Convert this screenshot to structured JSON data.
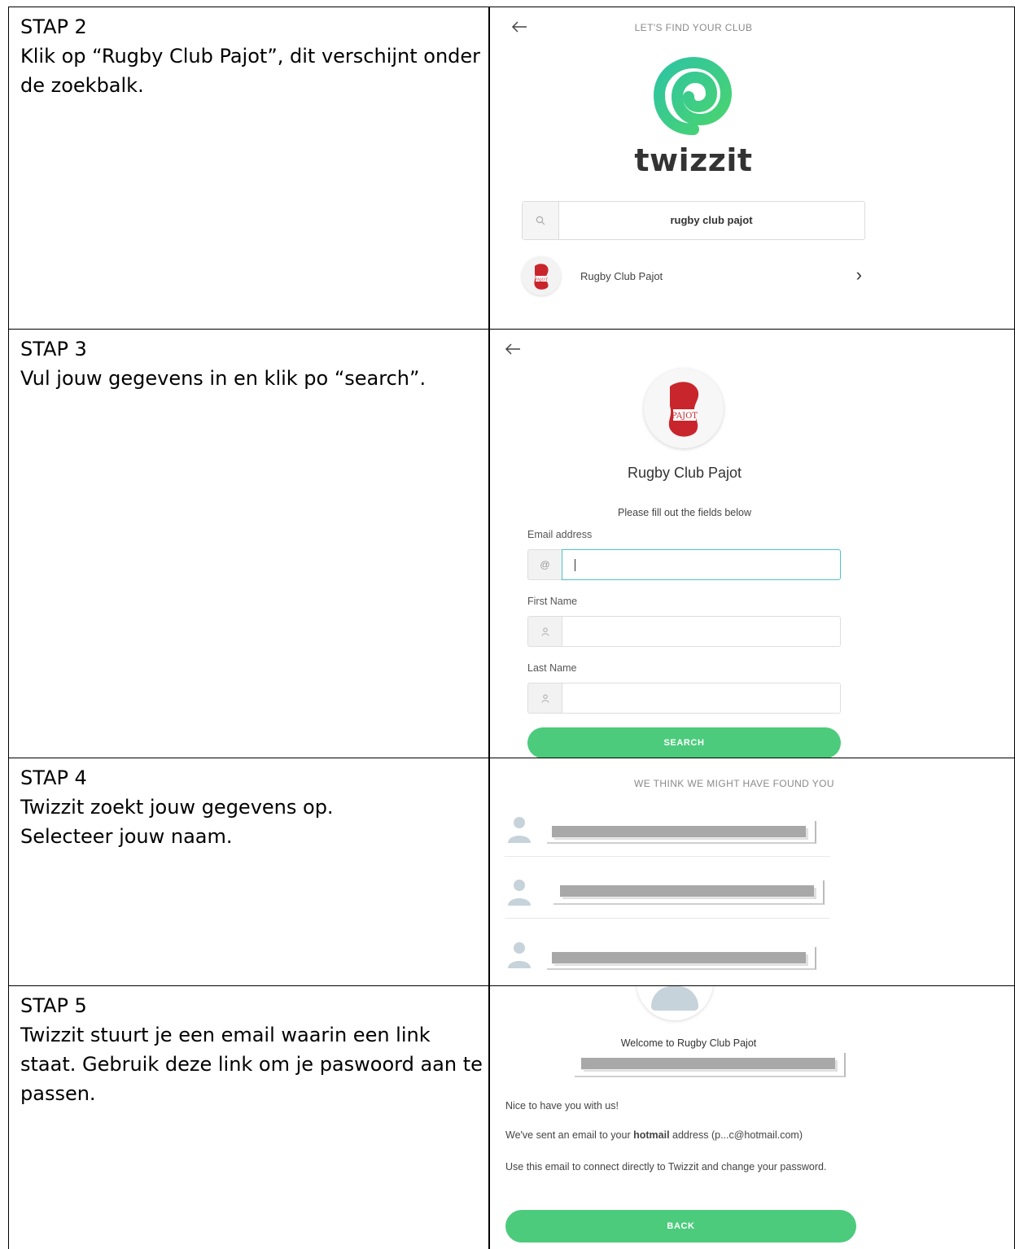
{
  "rows": [
    {
      "step": "STAP 2",
      "instruction": "Klik op “Rugby Club Pajot”, dit verschijnt onder de zoekbalk.",
      "screen": {
        "header": "LET'S FIND YOUR CLUB",
        "logo_text": "twizzit",
        "search_value": "rugby club pajot",
        "result_label": "Rugby Club Pajot",
        "result_chevron": "›"
      }
    },
    {
      "step": "STAP 3",
      "instruction": "Vul jouw gegevens in en klik po “search”.",
      "screen": {
        "club_name": "Rugby Club Pajot",
        "instructions": "Please fill out the fields below",
        "email_label": "Email address",
        "email_addon": "@",
        "first_name_label": "First Name",
        "last_name_label": "Last Name",
        "search_button": "SEARCH"
      }
    },
    {
      "step": "STAP 4",
      "instruction_lines": [
        "Twizzit zoekt jouw gegevens op.",
        "Selecteer jouw naam."
      ],
      "screen": {
        "header": "WE THINK WE MIGHT HAVE FOUND YOU"
      }
    },
    {
      "step": "STAP 5",
      "instruction": "Twizzit stuurt je een email waarin een link staat. Gebruik deze link om je paswoord aan te passen.",
      "screen": {
        "welcome": "Welcome to Rugby Club Pajot",
        "nice": "Nice to have you with us!",
        "sent_prefix": "We've sent an email to your ",
        "sent_bold": "hotmail",
        "sent_suffix": " address (p...c@hotmail.com)",
        "use_email": "Use this email to connect directly to Twizzit and change your password.",
        "back_button": "BACK"
      }
    }
  ],
  "colors": {
    "green_button": "#4ccb7c",
    "focus_border": "#4ec3c9",
    "logo_green": "#3cc97a",
    "redaction_gray": "#a8a8a8"
  }
}
